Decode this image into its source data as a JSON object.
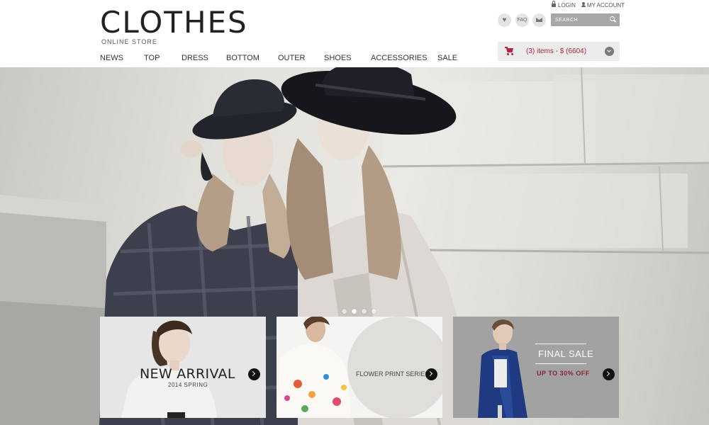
{
  "logo": {
    "title": "CLOTHES",
    "subtitle": "ONLINE STORE"
  },
  "nav": [
    "NEWS",
    "TOP",
    "DRESS",
    "BOTTOM",
    "OUTER",
    "SHOES",
    "ACCESSORIES",
    "SALE"
  ],
  "account": {
    "login": "LOGIN",
    "my_account": "MY ACCOUNT"
  },
  "icons": {
    "wishlist": "heart-icon",
    "faq_label": "FAQ",
    "mail": "mail-icon",
    "cart": "cart-icon"
  },
  "search": {
    "placeholder": "SEARCH"
  },
  "cart": {
    "summary": "(3)  items  -  $ (6604)"
  },
  "hero": {
    "slides": 4,
    "active_slide": 2
  },
  "promos": [
    {
      "title": "NEW ARRIVAL",
      "subtitle": "2014 SPRING"
    },
    {
      "title": "FLOWER PRINT SERIES"
    },
    {
      "title": "FINAL SALE",
      "subtitle": "UP TO 30% OFF"
    }
  ],
  "colors": {
    "accent": "#b2273d",
    "sale_text": "#8a2233",
    "search_bg": "#a7a7a7",
    "cart_bg": "#ececec"
  }
}
